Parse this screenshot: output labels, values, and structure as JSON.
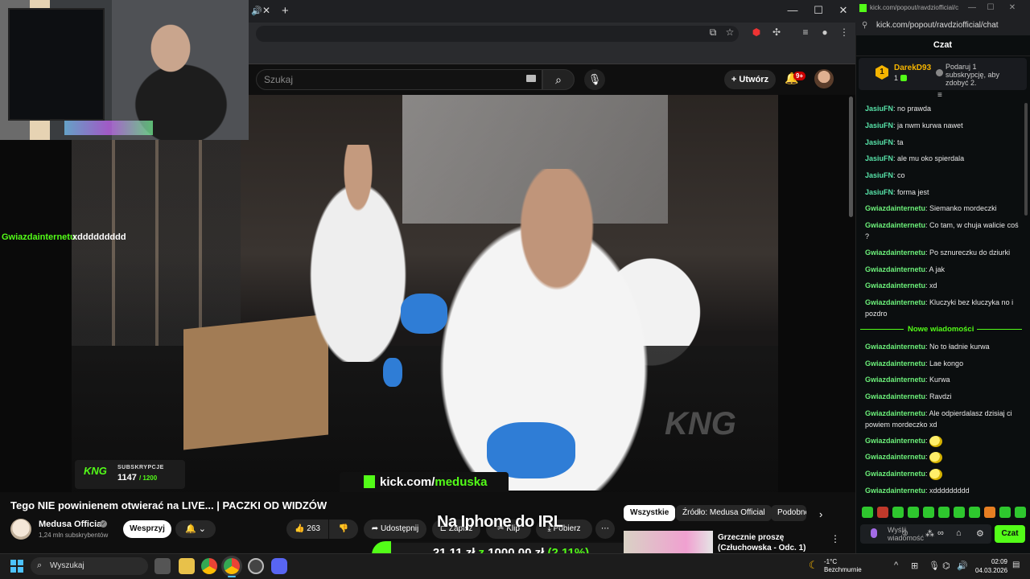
{
  "browser": {
    "tab_audio_icon": "speaker-icon",
    "new_tab": "+",
    "controls": {
      "minimize": "—",
      "maximize": "☐",
      "close": "✕"
    }
  },
  "youtube": {
    "search_placeholder": "Szukaj",
    "create_label": "Utwórz",
    "notification_badge": "9+",
    "video_title": "Tego NIE powinienem otwierać na LIVE... | PACZKI OD WIDZÓW",
    "channel": {
      "name": "Medusa Official",
      "subscribers": "1,24 mln subskrybentów"
    },
    "support_label": "Wesprzyj",
    "actions": {
      "likes": "263",
      "share": "Udostępnij",
      "save": "Zapisz",
      "clip": "Klip",
      "download": "Pobierz"
    },
    "chips": [
      "Wszystkie",
      "Źródło: Medusa Official",
      "Podobne"
    ],
    "recommended": {
      "title": "Grzecznie proszę (Człuchowska - Odc. 1)"
    }
  },
  "stream_overlay": {
    "floating_chat": {
      "user": "Gwiazdainternetu",
      "text": "xddddddddd"
    },
    "sub_goal": {
      "logo": "KNG",
      "label": "SUBSKRYPCJE",
      "current": "1147",
      "goal": "/ 1200"
    },
    "kick_banner": {
      "domain": "kick.com/",
      "channel": "meduska"
    },
    "watermark": "KNG",
    "donation": {
      "title": "Na Iphone do IRL",
      "raised": "21,11 zł",
      "separator": "z",
      "target": "1000,00 zł",
      "percent": "(2.11%)",
      "fraction": 0.0211
    }
  },
  "kick_chat": {
    "tab_title": "kick.com/popout/ravdziofficial/chat",
    "url": "kick.com/popout/ravdziofficial/chat",
    "header": "Czat",
    "pinned": {
      "rank": "1",
      "user": "DarekD93",
      "count": "1",
      "message": "Podaruj 1 subskrypcję, aby zdobyć 2."
    },
    "messages_before": [
      {
        "user": "JasiuFN",
        "text": "no prawda",
        "color": "teal"
      },
      {
        "user": "JasiuFN",
        "text": "ja nwm kurwa nawet",
        "color": "teal"
      },
      {
        "user": "JasiuFN",
        "text": "ta",
        "color": "teal"
      },
      {
        "user": "JasiuFN",
        "text": "ale mu oko spierdala",
        "color": "teal"
      },
      {
        "user": "JasiuFN",
        "text": "co",
        "color": "teal"
      },
      {
        "user": "JasiuFN",
        "text": "forma jest",
        "color": "teal"
      },
      {
        "user": "Gwiazdainternetu",
        "text": "Siemanko mordeczki",
        "color": "green"
      },
      {
        "user": "Gwiazdainternetu",
        "text": "Co tam, w chuja walicie coś ?",
        "color": "green"
      },
      {
        "user": "Gwiazdainternetu",
        "text": "Po sznureczku do dziurki",
        "color": "green"
      },
      {
        "user": "Gwiazdainternetu",
        "text": "A jak",
        "color": "green"
      },
      {
        "user": "Gwiazdainternetu",
        "text": "xd",
        "color": "green"
      },
      {
        "user": "Gwiazdainternetu",
        "text": "Kluczyki bez kluczyka no i pozdro",
        "color": "green"
      }
    ],
    "new_messages_label": "Nowe wiadomości",
    "messages_after": [
      {
        "user": "Gwiazdainternetu",
        "text": "No to ładnie kurwa",
        "color": "green"
      },
      {
        "user": "Gwiazdainternetu",
        "text": "Lae kongo",
        "color": "green"
      },
      {
        "user": "Gwiazdainternetu",
        "text": "Kurwa",
        "color": "green"
      },
      {
        "user": "Gwiazdainternetu",
        "text": "Ravdzi",
        "color": "green"
      },
      {
        "user": "Gwiazdainternetu",
        "text": "Ale odpierdalasz dzisiaj ci powiem mordeczko xd",
        "color": "green"
      },
      {
        "user": "Gwiazdainternetu",
        "text": "",
        "emote": true,
        "color": "green"
      },
      {
        "user": "Gwiazdainternetu",
        "text": "",
        "emote": true,
        "color": "green"
      },
      {
        "user": "Gwiazdainternetu",
        "text": "",
        "emote": true,
        "color": "green"
      },
      {
        "user": "Gwiazdainternetu",
        "text": "xddddddddd",
        "color": "green"
      }
    ],
    "input_placeholder": "Wyślij wiadomość",
    "send_label": "Czat"
  },
  "taskbar": {
    "search_placeholder": "Wyszukaj",
    "weather_temp": "-1°C",
    "weather_desc": "Bezchmurnie",
    "time": "02:09",
    "date": "04.03.2026"
  },
  "colors": {
    "kick_green": "#53fc18",
    "youtube_dark": "#0f0f0f",
    "chat_bg": "#0b0e0f"
  }
}
